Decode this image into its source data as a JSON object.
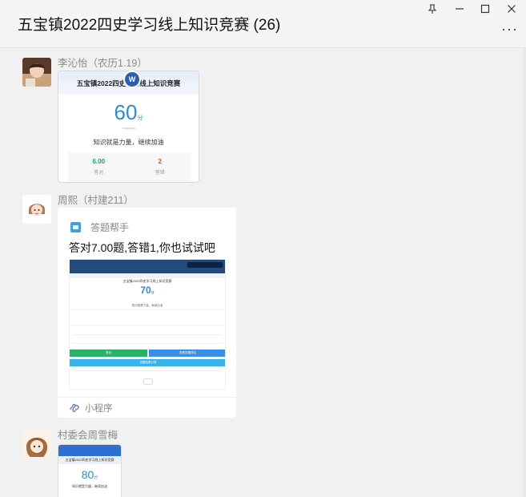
{
  "window": {
    "title": "五宝镇2022四史学习线上知识竞赛 (26)",
    "pin_icon": "pin-icon",
    "minimize_icon": "minimize-icon",
    "maximize_icon": "maximize-icon",
    "close_icon": "close-icon",
    "more_label": "···"
  },
  "messages": [
    {
      "sender": "李沁怡（农历1.19）",
      "card": {
        "title": "五宝镇2022四史学习线上知识竞赛",
        "badge": "W",
        "score": "60",
        "score_unit": "分",
        "subtitle": "知识就是力量，继续加油",
        "stats": [
          {
            "value": "6.00",
            "label": "答对",
            "color": "#1aad5a"
          },
          {
            "value": "2",
            "label": "答错",
            "color": "#e6552b"
          }
        ]
      }
    },
    {
      "sender": "周熙（村建211）",
      "card": {
        "app_name": "答题帮手",
        "message": "答对7.00题,答错1,你也试试吧",
        "preview": {
          "title": "五宝镇2022四史学习线上知识竞赛",
          "score": "70",
          "score_unit": "分",
          "text": "知识就是力量，继续加油",
          "buttons": [
            {
              "label": "首页",
              "color": "#27b36a"
            },
            {
              "label": "查看答题排名",
              "color": "#3b8ee8"
            },
            {
              "label": "答题结果分享",
              "color": "#3ab2ea"
            }
          ]
        },
        "footer": "小程序"
      }
    },
    {
      "sender": "村委会周雪梅",
      "card": {
        "title": "五宝镇2022四史学习线上知识竞赛",
        "score": "80",
        "score_unit": "分",
        "subtitle": "知识就是力量，继续加油"
      }
    }
  ]
}
